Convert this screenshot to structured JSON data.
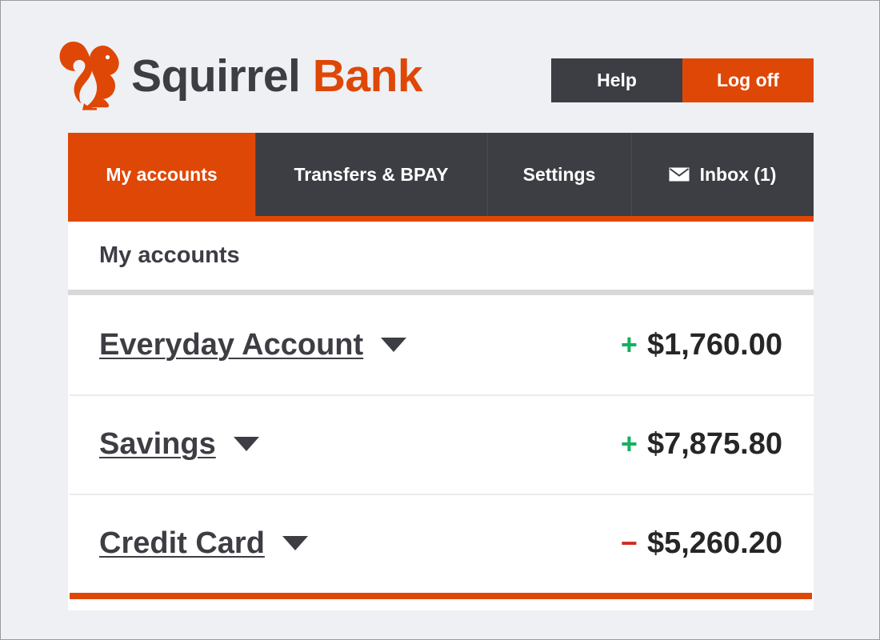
{
  "brand": {
    "logo_icon": "squirrel-icon",
    "name_primary": "Squirrel",
    "name_accent": "Bank",
    "accent_color": "#df4706",
    "dark_color": "#3d3d44"
  },
  "header": {
    "help_label": "Help",
    "logoff_label": "Log off"
  },
  "nav": {
    "tabs": [
      {
        "label": "My accounts",
        "active": true
      },
      {
        "label": "Transfers & BPAY",
        "active": false
      },
      {
        "label": "Settings",
        "active": false
      },
      {
        "label": "Inbox (1)",
        "active": false,
        "icon": "mail-icon"
      }
    ]
  },
  "main": {
    "page_title": "My accounts",
    "accounts": [
      {
        "name": "Everyday Account",
        "sign": "+",
        "amount": "$1,760.00",
        "sign_type": "pos"
      },
      {
        "name": "Savings",
        "sign": "+",
        "amount": "$7,875.80",
        "sign_type": "pos"
      },
      {
        "name": "Credit Card",
        "sign": "−",
        "amount": "$5,260.20",
        "sign_type": "neg"
      }
    ]
  },
  "colors": {
    "positive": "#11b261",
    "negative": "#d22a1e",
    "page_background": "#eef0f4"
  }
}
